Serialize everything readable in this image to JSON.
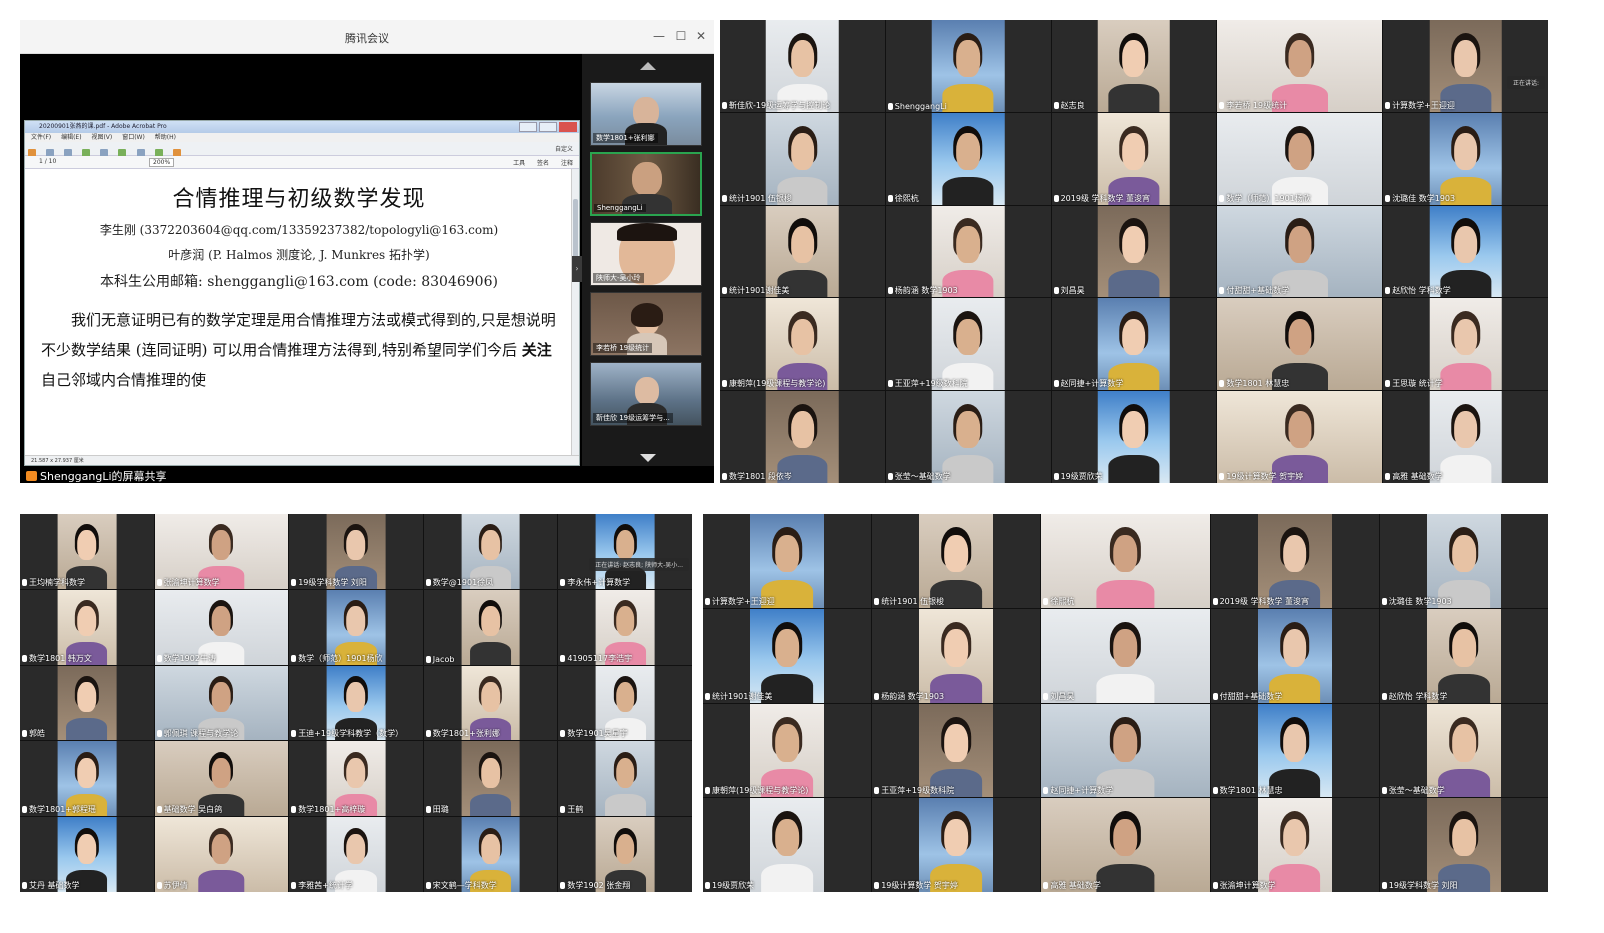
{
  "share_window": {
    "title": "腾讯会议",
    "min_icon": "minimize-icon",
    "max_icon": "maximize-icon",
    "close_icon": "close-icon",
    "acrobat": {
      "title": "20200901张燕的课.pdf - Adobe Acrobat Pro",
      "menu": [
        "文件(F)",
        "编辑(E)",
        "视图(V)",
        "窗口(W)",
        "帮助(H)"
      ],
      "toolbar_right": "自定义",
      "page_indicator": "1 / 10",
      "zoom": "200%",
      "right_tabs": [
        "工具",
        "签名",
        "注释"
      ],
      "status": "21.587 x 27.937 厘米"
    },
    "pdf": {
      "title": "合情推理与初级数学发现",
      "line1": "李生刚 (3372203604@qq.com/13359237382/topologyli@163.com)",
      "line2": "叶彦润 (P. Halmos 测度论,  J. Munkres 拓扑学)",
      "line3": "本科生公用邮箱:  shenggangli@163.com (code: 83046906)",
      "para_pre": "我们无意证明已有的数学定理是用合情推理方法或模式得到的,只是想说明不少数学结果 (连同证明) 可以用合情推理方法得到,特别希望同学们今后",
      "para_em": "关注",
      "para_post": "自己邻域内合情推理的使"
    },
    "strip": [
      {
        "name": "数学1801+张利娜"
      },
      {
        "name": "ShenggangLi"
      },
      {
        "name": "陕师大-吴小玲"
      },
      {
        "name": "李若桥 19级统计"
      },
      {
        "name": "靳佳欣 19级运筹学与..."
      }
    ],
    "footer_label": "ShenggangLi的屏幕共享"
  },
  "panel_b": {
    "speaking": "正在讲话: ",
    "tiles": [
      "靳佳欣-19级运筹学与控制论",
      "ShenggangLi",
      "赵志良",
      "李若桥 19级统计",
      "计算数学+王迎迎",
      "统计1901 伍银梭",
      "徐熙杭",
      "2019级 学科数学 董浚宵",
      "数学（师范）1901杨欣",
      "沈璐佳 数学1903",
      "统计1901谢佳美",
      "杨韵涵 数学1903",
      "刘昌昊",
      "付甜甜+基础数学",
      "赵欣怡 学科数学",
      "康朝萍(19级课程与教学论)",
      "王亚萍+19级数科院",
      "赵同捷+计算数学",
      "数学1801 林慧忠",
      "王思璇 统计学",
      "数学1801 段依岑",
      "张莹～基础数学",
      "19级贾欣荣",
      "19级计算数学 贺宇婷",
      "高雅 基础数学"
    ]
  },
  "panel_c": {
    "speaking": "正在讲话: 赵志良; 陕师大-吴小...",
    "tiles": [
      "王均楠学科数学",
      "张渝坤计算数学",
      "19级学科数学 刘阳",
      "数学@1901徐凤",
      "李永伟+计算数学",
      "数学1801 韩万文",
      "数学1902牛涛",
      "数学（师范）1901杨欣",
      "Jacob",
      "41905117李浩宇",
      "郭皓",
      "郭佩琪 课程与教学论",
      "王迪+19级学科教学（数学）",
      "数学1801+张利娜",
      "数学1901吴星宇",
      "数学1801+郭程瑶",
      "基础数学 吴白鸽",
      "数学1801+高梓璇",
      "田璐",
      "王鹤",
      "艾丹 基础数学",
      "苏伊倩",
      "李雅茜+统计学",
      "宋文鹤—学科数学",
      "数学1902 张金翔"
    ]
  },
  "panel_d": {
    "tiles": [
      "计算数学+王迎迎",
      "统计1901 伍银梭",
      "徐熙杭",
      "2019级 学科数学 董浚宵",
      "沈璐佳 数学1903",
      "统计1901谢佳美",
      "杨韵涵 数学1903",
      "刘昌昊",
      "付甜甜+基础数学",
      "赵欣怡 学科数学",
      "康朝萍(19级课程与教学论)",
      "王亚萍+19级数科院",
      "赵同捷+计算数学",
      "数学1801 林慧忠",
      "张莹～基础数学",
      "19级贾欣荣",
      "19级计算数学 贺宇婷",
      "高雅 基础数学",
      "张渝坤计算数学",
      "19级学科数学 刘阳"
    ]
  }
}
